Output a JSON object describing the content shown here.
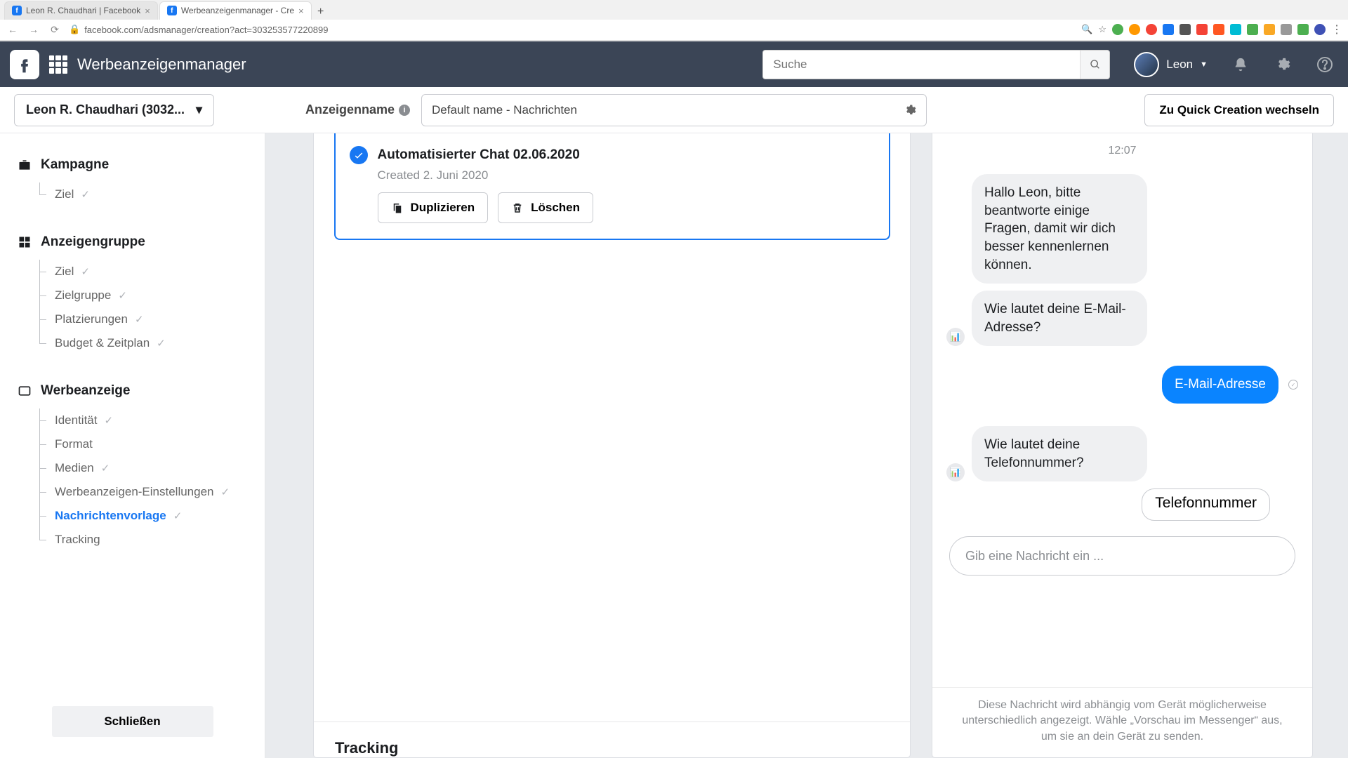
{
  "browser": {
    "tabs": [
      {
        "title": "Leon R. Chaudhari | Facebook"
      },
      {
        "title": "Werbeanzeigenmanager - Cre"
      }
    ],
    "url": "facebook.com/adsmanager/creation?act=303253577220899"
  },
  "header": {
    "app_title": "Werbeanzeigenmanager",
    "search_placeholder": "Suche",
    "username": "Leon"
  },
  "toolbar": {
    "account_label": "Leon R. Chaudhari (3032...",
    "ad_name_label": "Anzeigenname",
    "ad_name_value": "Default name - Nachrichten",
    "quick_creation": "Zu Quick Creation wechseln"
  },
  "sidebar": {
    "campaign": {
      "title": "Kampagne",
      "items": [
        "Ziel"
      ]
    },
    "adgroup": {
      "title": "Anzeigengruppe",
      "items": [
        "Ziel",
        "Zielgruppe",
        "Platzierungen",
        "Budget & Zeitplan"
      ]
    },
    "ad": {
      "title": "Werbeanzeige",
      "items": [
        "Identität",
        "Format",
        "Medien",
        "Werbeanzeigen-Einstellungen",
        "Nachrichtenvorlage",
        "Tracking"
      ]
    },
    "close": "Schließen"
  },
  "chat_card": {
    "title": "Automatisierter Chat 02.06.2020",
    "subtitle": "Created 2. Juni 2020",
    "duplicate": "Duplizieren",
    "delete": "Löschen"
  },
  "preview": {
    "time": "12:07",
    "msg1": "Hallo Leon, bitte beantworte einige Fragen, damit wir dich besser kennenlernen können.",
    "msg2": "Wie lautet deine E-Mail-Adresse?",
    "reply1": "E-Mail-Adresse",
    "msg3": "Wie lautet deine Telefonnummer?",
    "option1": "Telefonnummer",
    "input_placeholder": "Gib eine Nachricht ein ...",
    "disclaimer": "Diese Nachricht wird abhängig vom Gerät möglicherweise unterschiedlich angezeigt. Wähle „Vorschau im Messenger“ aus, um sie an dein Gerät zu senden."
  },
  "tracking": {
    "heading": "Tracking"
  }
}
